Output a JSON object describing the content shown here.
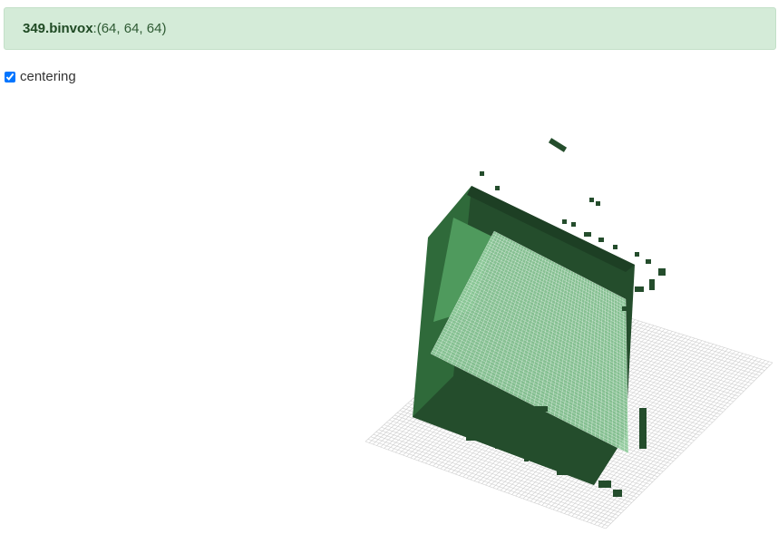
{
  "banner": {
    "filename": "349.binvox",
    "separator": ":",
    "dims": " (64, 64, 64)"
  },
  "controls": {
    "centering_label": "centering",
    "centering_checked": true
  },
  "viewer": {
    "colors": {
      "grid_line": "#cfcfcf",
      "voxel_dark": "#244d2c",
      "voxel_mid": "#2f6a3a",
      "voxel_light": "#4f9a5d",
      "voxel_pale": "#8ec99a"
    }
  }
}
